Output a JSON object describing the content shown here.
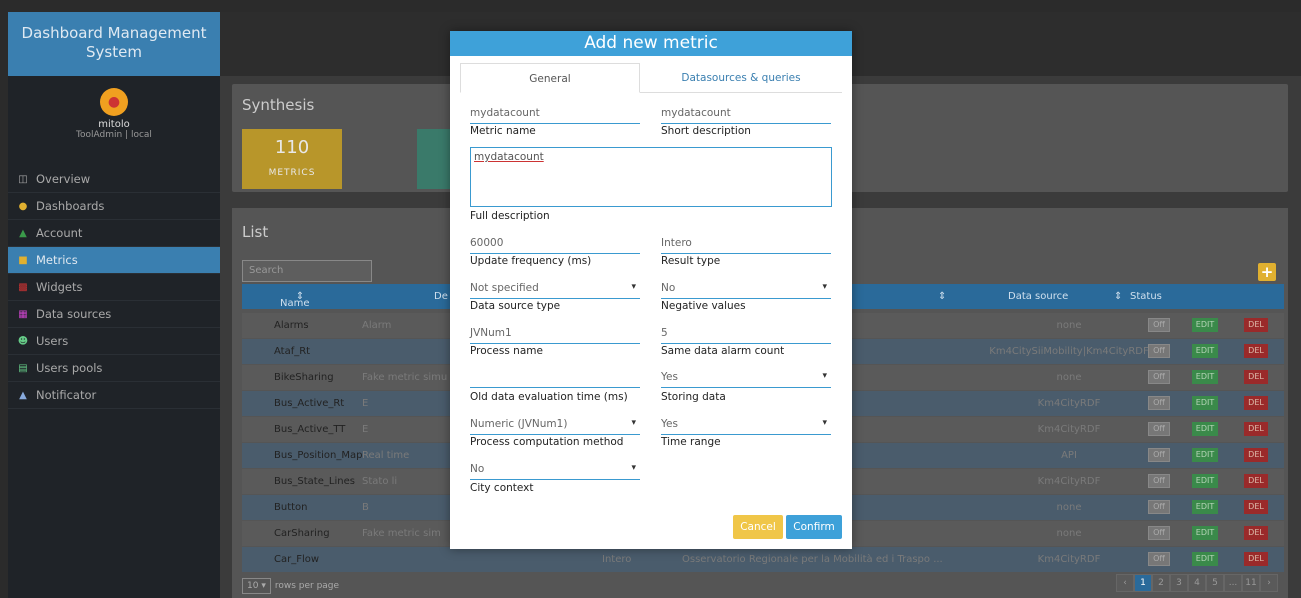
{
  "app": {
    "brand": "Dashboard Management System",
    "user_name": "mitolo",
    "user_role": "ToolAdmin | local"
  },
  "sidebar": {
    "items": [
      {
        "label": "Overview",
        "icon": "monitor-icon"
      },
      {
        "label": "Dashboards",
        "icon": "dashboard-icon"
      },
      {
        "label": "Account",
        "icon": "user-icon"
      },
      {
        "label": "Metrics",
        "icon": "metrics-icon",
        "active": true
      },
      {
        "label": "Widgets",
        "icon": "widgets-icon"
      },
      {
        "label": "Data sources",
        "icon": "database-icon"
      },
      {
        "label": "Users",
        "icon": "users-icon"
      },
      {
        "label": "Users pools",
        "icon": "users-pool-icon"
      },
      {
        "label": "Notificator",
        "icon": "bell-icon"
      }
    ]
  },
  "synthesis": {
    "title": "Synthesis",
    "metrics_count": "110",
    "metrics_label": "METRICS"
  },
  "list": {
    "title": "List",
    "search_placeholder": "Search",
    "columns": {
      "name": "Name",
      "desc": "De",
      "data_source": "Data source",
      "status": "Status"
    },
    "rows": [
      {
        "name": "Alarms",
        "desc": "Alarm",
        "mid": "",
        "source": "none"
      },
      {
        "name": "Ataf_Rt",
        "desc": "",
        "mid": "tà ed i Traspo ...",
        "source": "Km4CitySiiMobility|Km4CityRDF"
      },
      {
        "name": "BikeSharing",
        "desc": "Fake metric simu",
        "mid": "",
        "source": "none"
      },
      {
        "name": "Bus_Active_Rt",
        "desc": "E",
        "mid": "tà ed i Traspo ...",
        "source": "Km4CityRDF"
      },
      {
        "name": "Bus_Active_TT",
        "desc": "E",
        "mid": "tà ed i Traspo ...",
        "source": "Km4CityRDF"
      },
      {
        "name": "Bus_Position_Map",
        "desc": "Real time",
        "mid": "tà ed i Traspo ...",
        "source": "API"
      },
      {
        "name": "Bus_State_Lines",
        "desc": "Stato li",
        "mid": "tà ed i Traspo ...",
        "source": "Km4CityRDF"
      },
      {
        "name": "Button",
        "desc": "B",
        "mid": "",
        "source": "none"
      },
      {
        "name": "CarSharing",
        "desc": "Fake metric sim",
        "mid": "",
        "source": "none"
      },
      {
        "name": "Car_Flow",
        "desc": "",
        "type": "Intero",
        "mid": "Osservatorio Regionale per la Mobilità ed i Traspo ...",
        "source": "Km4CityRDF"
      }
    ],
    "status_off": "Off",
    "edit_label": "EDIT",
    "del_label": "DEL",
    "rows_per_page_value": "10 ▾",
    "rows_per_page_label": "rows per page",
    "pages": [
      "‹",
      "1",
      "2",
      "3",
      "4",
      "5",
      "...",
      "11",
      "›"
    ]
  },
  "modal": {
    "title": "Add new metric",
    "tab_general": "General",
    "tab_datasources": "Datasources & queries",
    "metric_name_value": "mydatacount",
    "metric_name_label": "Metric name",
    "short_desc_value": "mydatacount",
    "short_desc_label": "Short description",
    "full_desc_value": "mydatacount",
    "full_desc_label": "Full description",
    "update_freq_value": "60000",
    "update_freq_label": "Update frequency (ms)",
    "result_type_value": "Intero",
    "result_type_label": "Result type",
    "ds_type_value": "Not specified",
    "ds_type_label": "Data source type",
    "neg_values_value": "No",
    "neg_values_label": "Negative values",
    "process_name_value": "JVNum1",
    "process_name_label": "Process name",
    "same_alarm_value": "5",
    "same_alarm_label": "Same data alarm count",
    "old_eval_value": "",
    "old_eval_label": "Old data evaluation time (ms)",
    "storing_value": "Yes",
    "storing_label": "Storing data",
    "proc_method_value": "Numeric (JVNum1)",
    "proc_method_label": "Process computation method",
    "time_range_value": "Yes",
    "time_range_label": "Time range",
    "city_ctx_value": "No",
    "city_ctx_label": "City context",
    "cancel": "Cancel",
    "confirm": "Confirm"
  }
}
